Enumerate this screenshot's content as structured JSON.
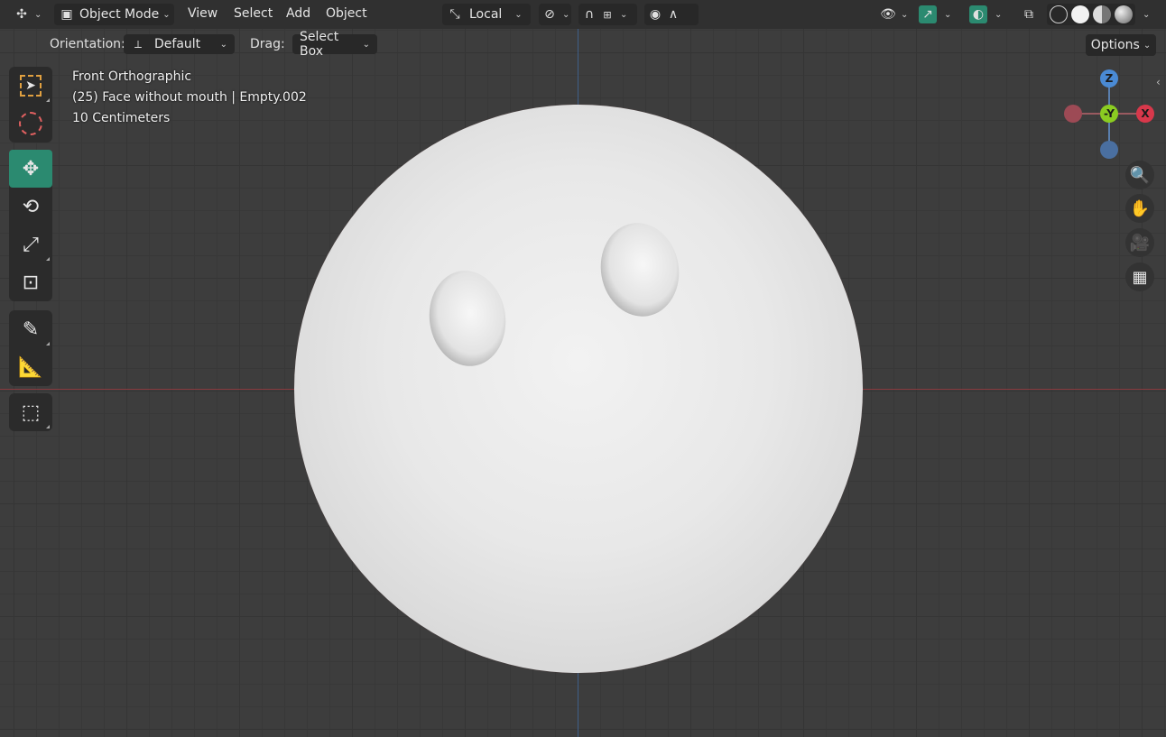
{
  "header": {
    "editor_type_icon": "transform-axes-icon",
    "mode_label": "Object Mode",
    "menus": [
      "View",
      "Select",
      "Add",
      "Object"
    ],
    "transform_orientation": "Local",
    "pivot_icon": "link-icon",
    "snap_icon": "magnet-icon",
    "snap_increment_icon": "increment-icon",
    "proportional_icon": "circle-dot-icon",
    "falloff_icon": "smooth-curve-icon",
    "visibility_icon": "eye-icon",
    "gizmo_icon": "gizmo-icon",
    "overlay_icon": "overlay-icon",
    "xray_icon": "xray-icon",
    "shading_modes": [
      "wireframe",
      "solid",
      "material",
      "rendered"
    ],
    "active_shading": "solid"
  },
  "subheader": {
    "orientation_label": "Orientation:",
    "orientation_value": "Default",
    "drag_label": "Drag:",
    "drag_value": "Select Box",
    "options_label": "Options"
  },
  "toolbar": {
    "tools": [
      "select-box-icon",
      "cursor-icon",
      "move-icon",
      "rotate-icon",
      "scale-icon",
      "transform-icon",
      "annotate-icon",
      "measure-icon",
      "add-cube-icon"
    ],
    "active_tool": "move-icon"
  },
  "overlay_info": {
    "view_name": "Front Orthographic",
    "object_info": "(25) Face without mouth | Empty.002",
    "scale": "10 Centimeters"
  },
  "navigation_gizmo": {
    "z_label": "Z",
    "y_label": "-Y",
    "x_label": "X",
    "colors": {
      "z": "#4a8ad4",
      "y": "#8bcc21",
      "x": "#d8384b",
      "neg_x": "#9d4a55",
      "neg_z": "#4a6fa0"
    }
  },
  "nav_buttons": [
    "zoom-icon",
    "hand-pan-icon",
    "camera-icon",
    "grid-icon"
  ]
}
